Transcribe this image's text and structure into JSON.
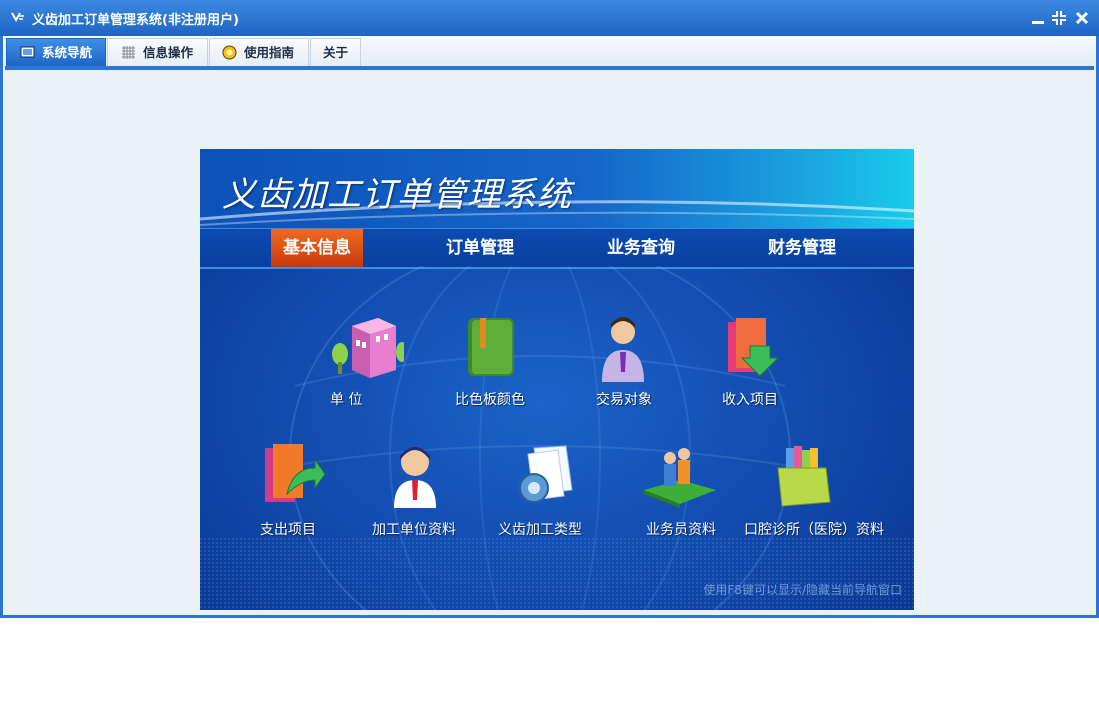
{
  "window": {
    "title": "义齿加工订单管理系统(非注册用户)"
  },
  "tabs": [
    {
      "label": "系统导航",
      "icon": "monitor-icon",
      "active": true
    },
    {
      "label": "信息操作",
      "icon": "grid-icon",
      "active": false
    },
    {
      "label": "使用指南",
      "icon": "lightbulb-icon",
      "active": false
    },
    {
      "label": "关于",
      "icon": "",
      "active": false
    }
  ],
  "banner": {
    "title": "义齿加工订单管理系统",
    "nav": [
      {
        "label": "基本信息",
        "active": true
      },
      {
        "label": "订单管理",
        "active": false
      },
      {
        "label": "业务查询",
        "active": false
      },
      {
        "label": "财务管理",
        "active": false
      }
    ],
    "modules": [
      {
        "label": "单    位",
        "icon": "building-icon"
      },
      {
        "label": "比色板颜色",
        "icon": "green-book-icon"
      },
      {
        "label": "交易对象",
        "icon": "businessman-icon"
      },
      {
        "label": "收入项目",
        "icon": "folder-download-icon"
      },
      {
        "label": "支出项目",
        "icon": "folder-export-icon"
      },
      {
        "label": "加工单位资料",
        "icon": "person-icon"
      },
      {
        "label": "义齿加工类型",
        "icon": "gear-document-icon"
      },
      {
        "label": "业务员资料",
        "icon": "people-book-icon"
      },
      {
        "label": "口腔诊所（医院）资料",
        "icon": "file-box-icon"
      }
    ],
    "hint": "使用F8键可以显示/隐藏当前导航窗口"
  },
  "colors": {
    "accent": "#2a76d2",
    "active_nav": "#e25a18"
  }
}
